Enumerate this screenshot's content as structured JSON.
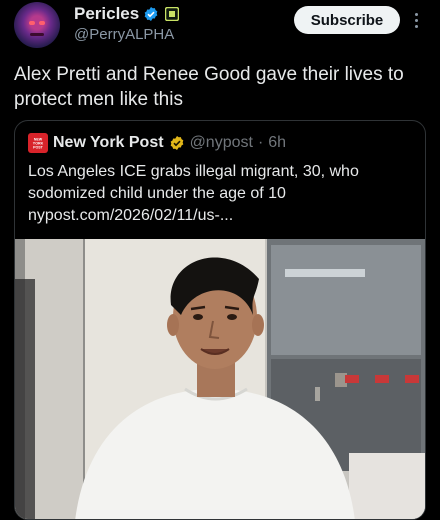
{
  "author": {
    "display_name": "Pericles",
    "handle": "@PerryALPHA"
  },
  "subscribe_label": "Subscribe",
  "tweet_text": "Alex Pretti and Renee Good gave their lives to protect men like this",
  "quote": {
    "source_name": "New York Post",
    "source_handle": "@nypost",
    "separator": "·",
    "time": "6h",
    "headline": "Los Angeles ICE grabs illegal migrant, 30, who sodomized child under the age of 10",
    "link": "nypost.com/2026/02/11/us-...",
    "logo_lines": [
      "NEW",
      "YORK",
      "POST"
    ]
  },
  "icons": {
    "verified": "verified-badge-icon",
    "square_badge": "affiliate-badge-icon",
    "more": "more-options-icon"
  },
  "colors": {
    "verified_blue": "#1d9bf0",
    "nypost_red": "#d8232a",
    "subscribe_bg": "#eff3f4",
    "secondary_text": "#8b98a5"
  }
}
